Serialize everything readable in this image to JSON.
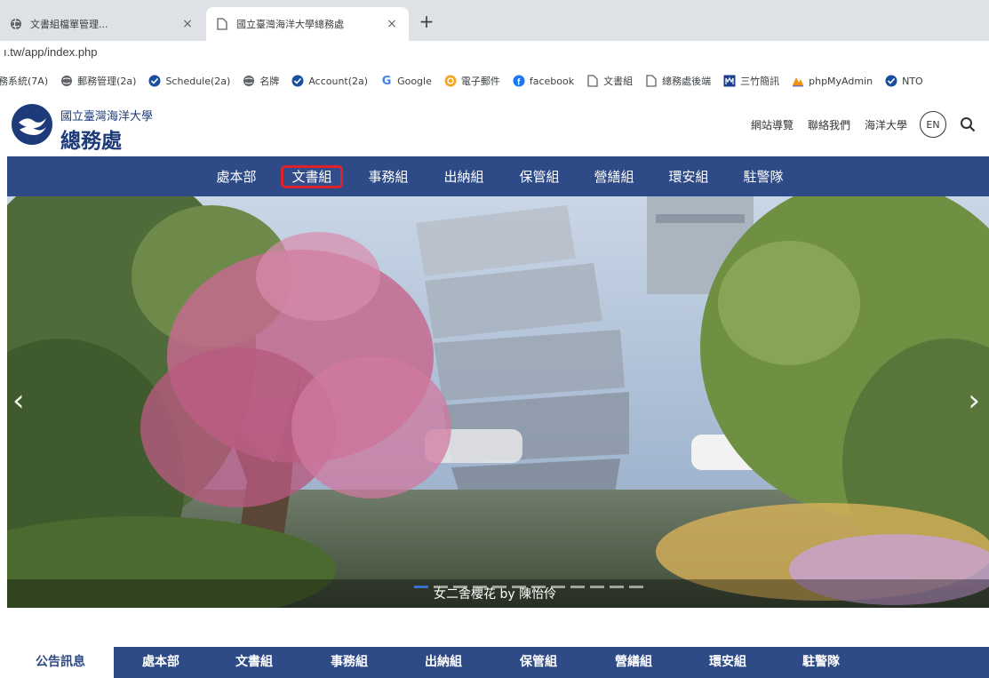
{
  "browser": {
    "tabs": [
      {
        "title": "文書組檔單管理...",
        "close": "×"
      },
      {
        "title": "國立臺灣海洋大學總務處",
        "close": "×"
      }
    ],
    "new_tab": "+",
    "url": "ı.tw/app/index.php",
    "bookmarks": [
      {
        "label": "務系統(7A)",
        "icon": "none"
      },
      {
        "label": "郵務管理(2a)",
        "icon": "globe-icon"
      },
      {
        "label": "Schedule(2a)",
        "icon": "check-badge-icon"
      },
      {
        "label": "名牌",
        "icon": "globe-icon"
      },
      {
        "label": "Account(2a)",
        "icon": "check-badge-icon"
      },
      {
        "label": "Google",
        "icon": "google-icon"
      },
      {
        "label": "電子郵件",
        "icon": "mail-icon"
      },
      {
        "label": "facebook",
        "icon": "facebook-icon"
      },
      {
        "label": "文書組",
        "icon": "page-icon"
      },
      {
        "label": "總務處後端",
        "icon": "page-icon"
      },
      {
        "label": "三竹簡訊",
        "icon": "mitake-icon"
      },
      {
        "label": "phpMyAdmin",
        "icon": "phpmyadmin-icon"
      },
      {
        "label": "NTO",
        "icon": "check-badge-icon"
      }
    ]
  },
  "header": {
    "org_small": "國立臺灣海洋大學",
    "org_big": "總務處",
    "links": [
      "網站導覽",
      "聯絡我們",
      "海洋大學"
    ],
    "lang_badge": "EN"
  },
  "nav": {
    "items": [
      "處本部",
      "文書組",
      "事務組",
      "出納組",
      "保管組",
      "營繕組",
      "環安組",
      "駐警隊"
    ],
    "highlighted": "文書組"
  },
  "hero": {
    "caption": "女二舍櫻花 by 陳怡伶",
    "prev": "‹",
    "next": "›"
  },
  "bottom_tabs": {
    "active": "公告訊息",
    "items": [
      "處本部",
      "文書組",
      "事務組",
      "出納組",
      "保管組",
      "營繕組",
      "環安組",
      "駐警隊"
    ]
  },
  "colors": {
    "nav_bg": "#2e4a87",
    "highlight_border": "#e0202a",
    "logo_blue": "#1d3b7a"
  }
}
